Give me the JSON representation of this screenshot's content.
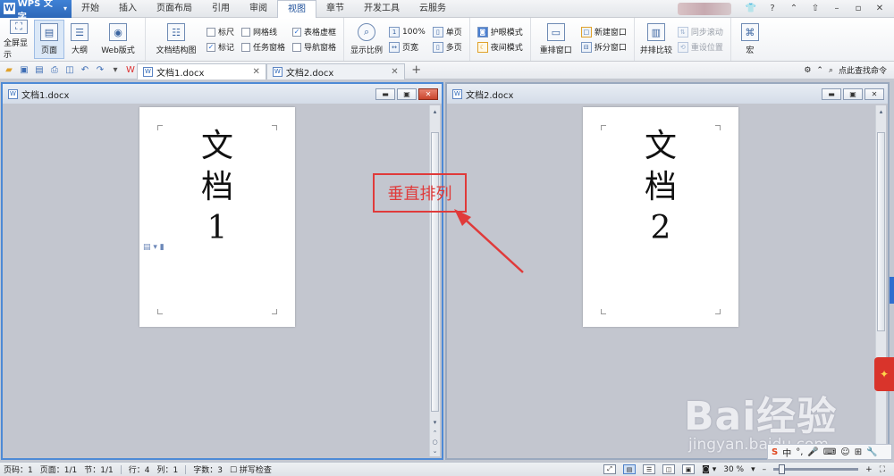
{
  "app": {
    "name": "WPS 文字"
  },
  "menu": {
    "tabs": [
      "开始",
      "插入",
      "页面布局",
      "引用",
      "审阅",
      "视图",
      "章节",
      "开发工具",
      "云服务"
    ],
    "active": "视图"
  },
  "ribbon": {
    "fullscreen": "全屏显示",
    "page": "页面",
    "outline": "大纲",
    "web": "Web版式",
    "doc_map": "文档结构图",
    "ruler": "标尺",
    "gridlines": "网格线",
    "table_gridlines": "表格虚框",
    "marks": "标记",
    "task_pane": "任务窗格",
    "nav_pane": "导航窗格",
    "zoom": "显示比例",
    "pct100": "100%",
    "page_width": "页宽",
    "one_page": "单页",
    "multi_page": "多页",
    "eye_mode": "护眼模式",
    "night_mode": "夜间模式",
    "arrange": "重排窗口",
    "new_window": "新建窗口",
    "split": "拆分窗口",
    "side_by_side": "并排比较",
    "sync_scroll": "同步滚动",
    "reset_pos": "重设位置",
    "macro": "宏"
  },
  "quickbar": {
    "tabs": [
      {
        "label": "文档1.docx"
      },
      {
        "label": "文档2.docx"
      }
    ],
    "search_cmd": "点此查找命令"
  },
  "windows": [
    {
      "title": "文档1.docx",
      "page_lines": [
        "文",
        "档",
        "1"
      ]
    },
    {
      "title": "文档2.docx",
      "page_lines": [
        "文",
        "档",
        "2"
      ]
    }
  ],
  "annotation": {
    "text": "垂直排列",
    "color": "#e03a3a"
  },
  "watermark": {
    "brand": "Bai经验",
    "url": "jingyan.baidu.com"
  },
  "ime": {
    "label": "中"
  },
  "statusbar": {
    "page_code": "页码：1",
    "pages": "页面：1/1",
    "section": "节：1/1",
    "line": "行：4",
    "column": "列：1",
    "word_count": "字数：3",
    "spell": "拼写检查",
    "zoom": "30 %"
  },
  "colors": {
    "accent": "#2d67b8",
    "active_border": "#4d8ad6"
  }
}
